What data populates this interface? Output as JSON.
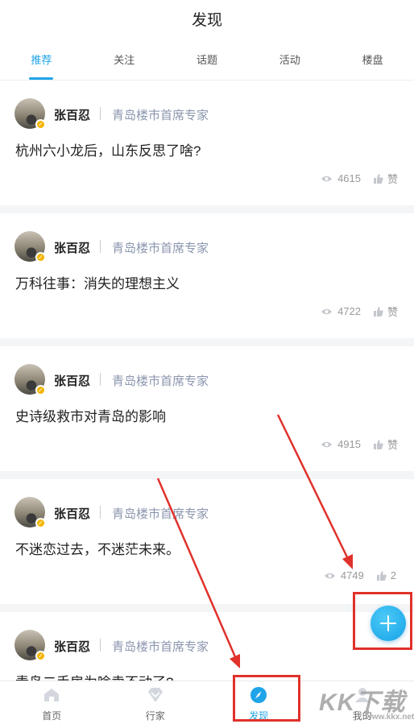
{
  "header": {
    "title": "发现"
  },
  "tabs": [
    {
      "label": "推荐",
      "active": true
    },
    {
      "label": "关注",
      "active": false
    },
    {
      "label": "话题",
      "active": false
    },
    {
      "label": "活动",
      "active": false
    },
    {
      "label": "楼盘",
      "active": false
    }
  ],
  "posts": [
    {
      "author": "张百忍",
      "role": "青岛楼市首席专家",
      "title": "杭州六小龙后，山东反思了啥?",
      "views": "4615",
      "likes": "赞"
    },
    {
      "author": "张百忍",
      "role": "青岛楼市首席专家",
      "title": "万科往事：消失的理想主义",
      "views": "4722",
      "likes": "赞"
    },
    {
      "author": "张百忍",
      "role": "青岛楼市首席专家",
      "title": "史诗级救市对青岛的影响",
      "views": "4915",
      "likes": "赞"
    },
    {
      "author": "张百忍",
      "role": "青岛楼市首席专家",
      "title": "不迷恋过去，不迷茫未来。",
      "views": "4749",
      "likes": "2"
    },
    {
      "author": "张百忍",
      "role": "青岛楼市首席专家",
      "title": "青岛二手房为啥卖不动了?",
      "views": "",
      "likes": ""
    }
  ],
  "bottom_nav": [
    {
      "label": "首页",
      "icon": "home-icon",
      "active": false
    },
    {
      "label": "行家",
      "icon": "diamond-icon",
      "active": false
    },
    {
      "label": "发现",
      "icon": "compass-icon",
      "active": true
    },
    {
      "label": "我的",
      "icon": "user-icon",
      "active": false
    }
  ],
  "watermark": {
    "main": "KK下载",
    "sub": "www.kkx.net"
  },
  "colors": {
    "accent": "#1fa4e8",
    "annotation": "#e0312b",
    "role_text": "#8b96ae"
  }
}
